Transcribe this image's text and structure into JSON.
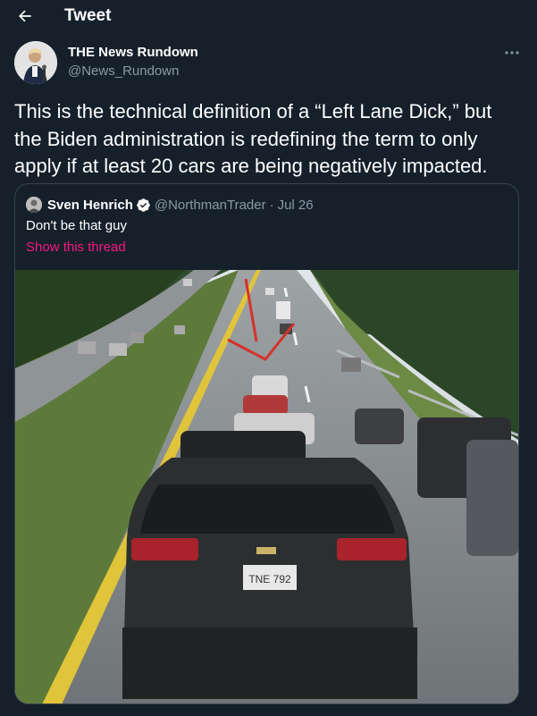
{
  "header": {
    "title": "Tweet"
  },
  "author": {
    "name": "THE News Rundown",
    "handle": "@News_Rundown"
  },
  "tweet": {
    "text": "This is the technical definition of a “Left Lane Dick,” but the Biden administration is redefining the term to only apply if at least 20 cars are being negatively impacted."
  },
  "quote": {
    "name": "Sven Henrich",
    "handle": "@NorthmanTrader",
    "separator": "·",
    "date": "Jul 26",
    "text": "Don't be that guy",
    "thread_link": "Show this thread",
    "plate": "TNE 792"
  },
  "colors": {
    "background": "#15202b",
    "secondary_text": "#8b98a5",
    "border": "#38444d",
    "link_accent": "#f91880",
    "verified": "#ffffff"
  },
  "icons": {
    "back": "arrow-left-icon",
    "more": "more-horizontal-icon",
    "verified": "verified-badge-icon"
  }
}
